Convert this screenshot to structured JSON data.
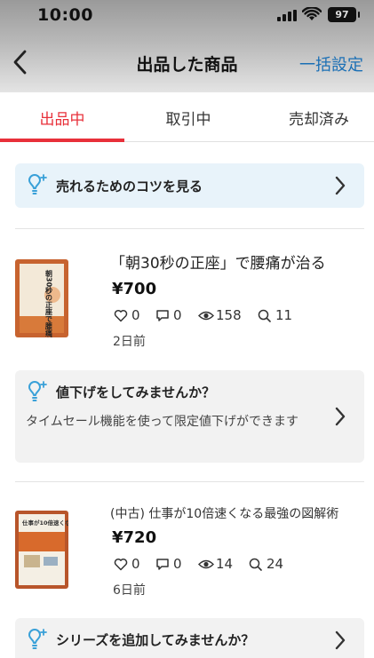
{
  "status_bar": {
    "time": "10:00",
    "battery": "97"
  },
  "header": {
    "title": "出品した商品",
    "bulk_settings": "一括設定"
  },
  "tabs": [
    {
      "label": "出品中",
      "active": true
    },
    {
      "label": "取引中",
      "active": false
    },
    {
      "label": "売却済み",
      "active": false
    }
  ],
  "tip_banner": {
    "label": "売れるためのコツを見る"
  },
  "items": [
    {
      "name": "「朝30秒の正座」で腰痛が治る",
      "price": "¥700",
      "likes": "0",
      "comments": "0",
      "views": "158",
      "searches": "11",
      "listed": "2日前",
      "cover_text": "朝30秒の正座で腰痛が治る",
      "suggestion": {
        "title": "値下げをしてみませんか？",
        "description": "タイムセール機能を使って限定値下げができます"
      }
    },
    {
      "name": "(中古) 仕事が10倍速くなる最強の図解術",
      "price": "¥720",
      "likes": "0",
      "comments": "0",
      "views": "14",
      "searches": "24",
      "listed": "6日前",
      "cover_text": "仕事が10倍速くなる 最強の図解術",
      "suggestion": {
        "title": "シリーズを追加してみませんか？"
      }
    }
  ],
  "colors": {
    "accent_red": "#e8303a",
    "link_blue": "#1a6fb5",
    "tip_bg": "#e8f3fa",
    "bulb": "#39a0d8"
  }
}
